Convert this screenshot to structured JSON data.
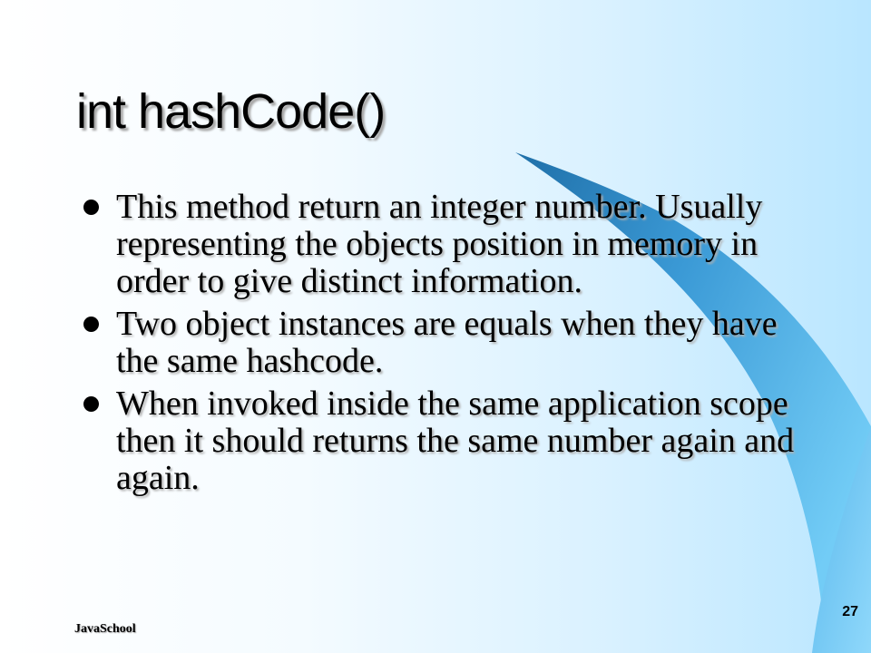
{
  "slide": {
    "title": "int hashCode()",
    "bullets": [
      "This method return an integer number. Usually representing the objects position in memory in order to give distinct information.",
      "Two object instances are equals when they have the same hashcode.",
      "When invoked inside the same application scope then it should returns the same number again and again."
    ],
    "footer": "JavaSchool",
    "page_number": "27"
  },
  "colors": {
    "background_light": "#ffffff",
    "background_blue": "#b9e6ff",
    "swoosh_dark": "#2f86c2",
    "swoosh_light": "#6dc8f5"
  }
}
